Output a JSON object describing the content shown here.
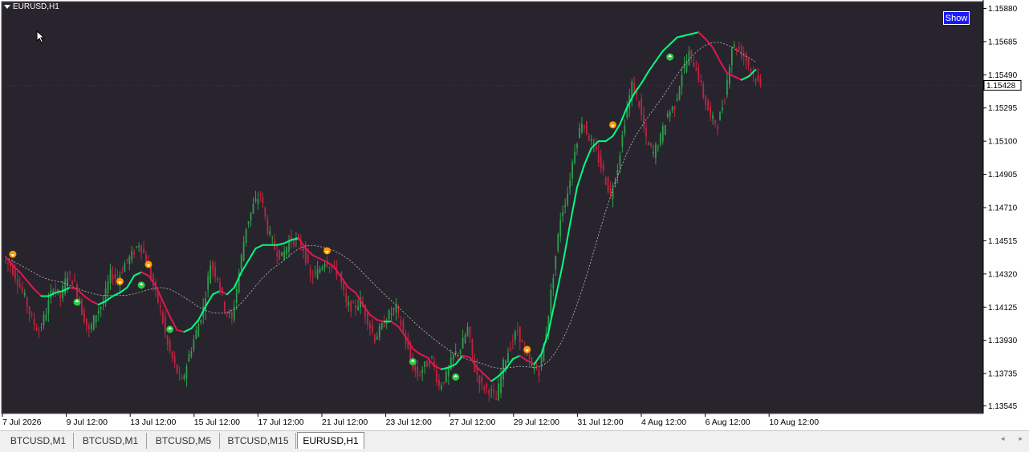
{
  "window": {
    "symbol": "EURUSD,H1",
    "show_label": "Show",
    "current_price_label": "1.15428"
  },
  "colors": {
    "background": "#28242e",
    "bull_candle": "#2e9e4a",
    "bear_candle": "#c0243f",
    "ma_up": "#00ff7f",
    "ma_down": "#e0174f",
    "ma_slow": "#bdbdbd",
    "arrow_up": "#2ecc40",
    "arrow_down": "#ff9900",
    "axis_text": "#000000"
  },
  "chart_data": {
    "type": "candlestick",
    "price_axis": {
      "ticks": [
        "1.15880",
        "1.15685",
        "1.15490",
        "1.15295",
        "1.15100",
        "1.14905",
        "1.14710",
        "1.14515",
        "1.14320",
        "1.14125",
        "1.13930",
        "1.13735",
        "1.13545"
      ],
      "range": [
        1.135,
        1.1592
      ]
    },
    "time_axis": {
      "ticks": [
        "7 Jul 2026",
        "9 Jul 12:00",
        "13 Jul 12:00",
        "15 Jul 12:00",
        "17 Jul 12:00",
        "21 Jul 12:00",
        "23 Jul 12:00",
        "27 Jul 12:00",
        "29 Jul 12:00",
        "31 Jul 12:00",
        "4 Aug 12:00",
        "6 Aug 12:00",
        "10 Aug 12:00"
      ]
    },
    "current_price": 1.15428,
    "closes": [
      1.1437,
      1.1428,
      1.1418,
      1.1405,
      1.1398,
      1.141,
      1.1425,
      1.1418,
      1.1432,
      1.1426,
      1.141,
      1.1398,
      1.1409,
      1.1415,
      1.1432,
      1.1429,
      1.1438,
      1.1443,
      1.145,
      1.1441,
      1.1425,
      1.1411,
      1.139,
      1.1378,
      1.1368,
      1.1384,
      1.1398,
      1.1412,
      1.1438,
      1.143,
      1.1412,
      1.1405,
      1.1433,
      1.146,
      1.1472,
      1.1479,
      1.1458,
      1.1447,
      1.1442,
      1.1451,
      1.1452,
      1.1447,
      1.143,
      1.1433,
      1.144,
      1.1436,
      1.1432,
      1.1414,
      1.1412,
      1.1416,
      1.1405,
      1.1394,
      1.1401,
      1.1408,
      1.1412,
      1.1398,
      1.1381,
      1.1372,
      1.1378,
      1.1382,
      1.1366,
      1.1372,
      1.1384,
      1.1388,
      1.14,
      1.1376,
      1.1366,
      1.1364,
      1.1358,
      1.1379,
      1.139,
      1.1399,
      1.1386,
      1.1378,
      1.1375,
      1.1398,
      1.1432,
      1.1465,
      1.148,
      1.1506,
      1.1522,
      1.1512,
      1.1503,
      1.1491,
      1.1478,
      1.1495,
      1.1522,
      1.1543,
      1.1532,
      1.151,
      1.1503,
      1.1512,
      1.1526,
      1.1531,
      1.155,
      1.1561,
      1.1553,
      1.1537,
      1.1524,
      1.152,
      1.1536,
      1.1566,
      1.1564,
      1.1558,
      1.1549,
      1.1542
    ],
    "markers": {
      "up": [
        10,
        19,
        23,
        57,
        63,
        93
      ],
      "down": [
        1,
        16,
        20,
        45,
        73,
        85
      ]
    },
    "fast_ma": [
      1.1442,
      1.1437,
      1.1433,
      1.1428,
      1.1423,
      1.1419,
      1.1419,
      1.1421,
      1.1422,
      1.1424,
      1.1423,
      1.1419,
      1.1416,
      1.1414,
      1.1416,
      1.1419,
      1.1421,
      1.1424,
      1.1431,
      1.1433,
      1.1431,
      1.1425,
      1.1416,
      1.1407,
      1.1399,
      1.1398,
      1.14,
      1.1405,
      1.1413,
      1.142,
      1.1422,
      1.142,
      1.1424,
      1.1433,
      1.144,
      1.1447,
      1.1449,
      1.1449,
      1.1449,
      1.145,
      1.1452,
      1.1453,
      1.1447,
      1.1443,
      1.1441,
      1.1439,
      1.1436,
      1.143,
      1.1424,
      1.1421,
      1.1414,
      1.1408,
      1.1405,
      1.1404,
      1.1404,
      1.1401,
      1.1395,
      1.1388,
      1.1385,
      1.1383,
      1.1378,
      1.1376,
      1.1377,
      1.1379,
      1.1384,
      1.1383,
      1.1377,
      1.1373,
      1.1369,
      1.1372,
      1.1376,
      1.1382,
      1.1384,
      1.1381,
      1.1379,
      1.1385,
      1.1398,
      1.1418,
      1.1438,
      1.1461,
      1.1483,
      1.1496,
      1.1506,
      1.151,
      1.151,
      1.1513,
      1.152,
      1.153,
      1.1538,
      1.1544,
      1.1551,
      1.1557,
      1.1563,
      1.1567,
      1.1571,
      1.1572,
      1.1573,
      1.1574,
      1.157,
      1.1565,
      1.1557,
      1.155,
      1.1548,
      1.1546,
      1.1548,
      1.1552
    ]
  },
  "tabs": [
    {
      "label": "BTCUSD,M1"
    },
    {
      "label": "BTCUSD,M1"
    },
    {
      "label": "BTCUSD,M5"
    },
    {
      "label": "BTCUSD,M15"
    },
    {
      "label": "EURUSD,H1"
    }
  ],
  "tab_nav": {
    "prev": "◂",
    "next": "▸"
  }
}
